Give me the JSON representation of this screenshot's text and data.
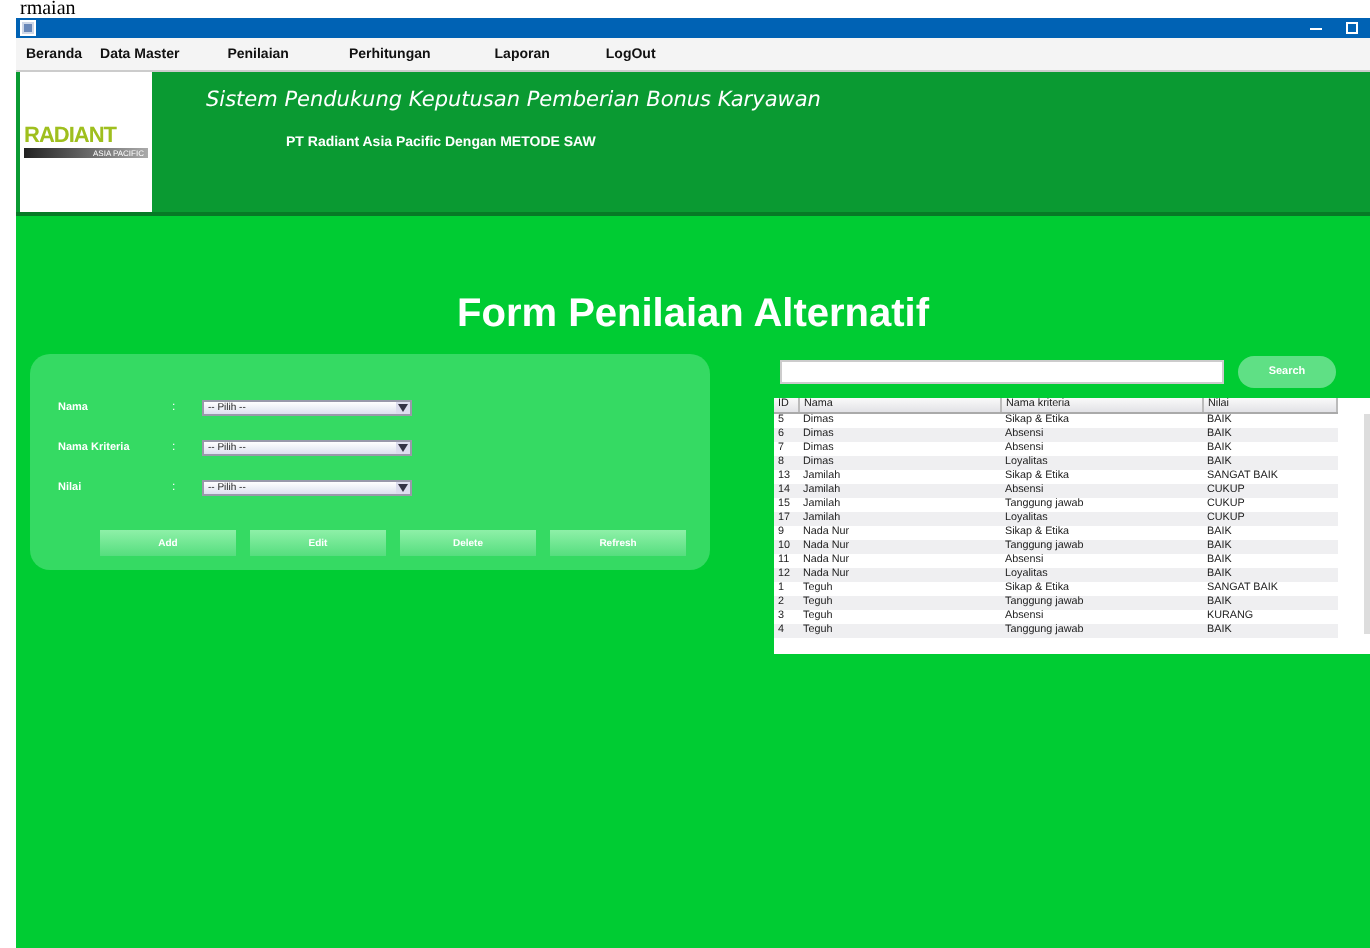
{
  "document_fragment": "rmaian",
  "menu": [
    "Beranda",
    "Data Master",
    "Penilaian",
    "Perhitungan",
    "Laporan",
    "LogOut"
  ],
  "header": {
    "logo": {
      "name": "RADIANT",
      "sub": "ASIA PACIFIC"
    },
    "title": "Sistem Pendukung Keputusan Pemberian Bonus Karyawan",
    "subtitle": "PT Radiant Asia Pacific Dengan METODE SAW"
  },
  "form_title": "Form Penilaian Alternatif",
  "fields": [
    {
      "label": "Nama",
      "colon": ":",
      "value": "-- Pilih --"
    },
    {
      "label": "Nama Kriteria",
      "colon": ":",
      "value": "-- Pilih --"
    },
    {
      "label": "Nilai",
      "colon": ":",
      "value": "-- Pilih --"
    }
  ],
  "buttons": [
    "Add",
    "Edit",
    "Delete",
    "Refresh"
  ],
  "search": {
    "button": "Search"
  },
  "table": {
    "columns": [
      "ID",
      "Nama",
      "Nama kriteria",
      "Nilai"
    ],
    "rows": [
      [
        "5",
        "Dimas",
        "Sikap & Etika",
        "BAIK"
      ],
      [
        "6",
        "Dimas",
        "Absensi",
        "BAIK"
      ],
      [
        "7",
        "Dimas",
        "Absensi",
        "BAIK"
      ],
      [
        "8",
        "Dimas",
        "Loyalitas",
        "BAIK"
      ],
      [
        "13",
        "Jamilah",
        "Sikap & Etika",
        "SANGAT BAIK"
      ],
      [
        "14",
        "Jamilah",
        "Absensi",
        "CUKUP"
      ],
      [
        "15",
        "Jamilah",
        "Tanggung jawab",
        "CUKUP"
      ],
      [
        "17",
        "Jamilah",
        "Loyalitas",
        "CUKUP"
      ],
      [
        "9",
        "Nada Nur",
        "Sikap & Etika",
        "BAIK"
      ],
      [
        "10",
        "Nada Nur",
        "Tanggung jawab",
        "BAIK"
      ],
      [
        "11",
        "Nada Nur",
        "Absensi",
        "BAIK"
      ],
      [
        "12",
        "Nada Nur",
        "Loyalitas",
        "BAIK"
      ],
      [
        "1",
        "Teguh",
        "Sikap & Etika",
        "SANGAT BAIK"
      ],
      [
        "2",
        "Teguh",
        "Tanggung jawab",
        "BAIK"
      ],
      [
        "3",
        "Teguh",
        "Absensi",
        "KURANG"
      ],
      [
        "4",
        "Teguh",
        "Tanggung jawab",
        "BAIK"
      ]
    ]
  }
}
